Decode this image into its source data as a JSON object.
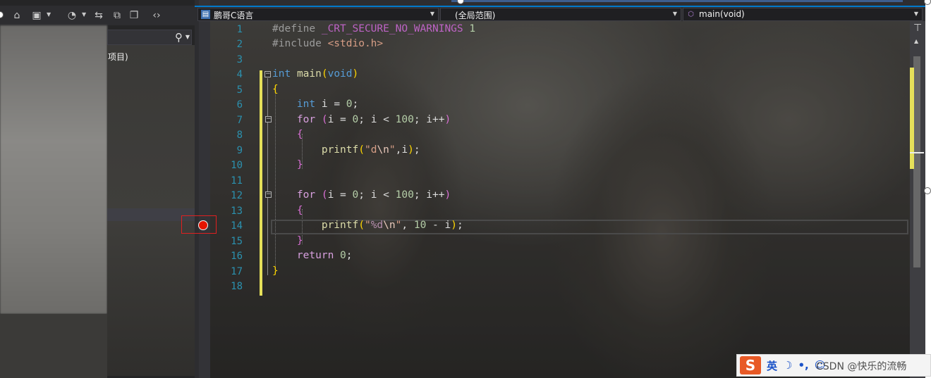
{
  "nav": {
    "file_combo": "鹏哥C语言",
    "scope_combo": "(全局范围)",
    "member_combo": "main(void)"
  },
  "solution_explorer": {
    "tree_item_partial": "项目)"
  },
  "editor": {
    "line_numbers": [
      "1",
      "2",
      "3",
      "4",
      "5",
      "6",
      "7",
      "8",
      "9",
      "10",
      "11",
      "12",
      "13",
      "14",
      "15",
      "16",
      "17",
      "18"
    ],
    "lines": {
      "l1_pp": "#define",
      "l1_macro": "_CRT_SECURE_NO_WARNINGS",
      "l1_num": "1",
      "l2_pp": "#include",
      "l2_header": "<stdio.h>",
      "l4_kw": "int",
      "l4_name": "main",
      "l4_open": "(",
      "l4_param": "void",
      "l4_close": ")",
      "l5": "{",
      "l6_kw": "int",
      "l6_rest": " i = ",
      "l6_num": "0",
      "l6_end": ";",
      "l7_kw": "for",
      "l7_open": "(",
      "l7_a": "i = ",
      "l7_n0": "0",
      "l7_b": "; i < ",
      "l7_n100": "100",
      "l7_c": "; i++",
      "l7_close": ")",
      "l8": "{",
      "l9_fn": "printf",
      "l9_open": "(",
      "l9_str_a": "\"d",
      "l9_esc": "\\n",
      "l9_str_b": "\"",
      "l9_args": ",i",
      "l9_close": ")",
      "l9_end": ";",
      "l10": "}",
      "l12_kw": "for",
      "l12_open": "(",
      "l12_a": "i = ",
      "l12_n0": "0",
      "l12_b": "; i < ",
      "l12_n100": "100",
      "l12_c": "; i++",
      "l12_close": ")",
      "l13": "{",
      "l14_fn": "printf",
      "l14_open": "(",
      "l14_str_a": "\"",
      "l14_fmt": "%d",
      "l14_esc": "\\n",
      "l14_str_b": "\"",
      "l14_args_a": ", ",
      "l14_n10": "10",
      "l14_args_b": " - i",
      "l14_close": ")",
      "l14_end": ";",
      "l15": "}",
      "l16_kw": "return",
      "l16_sp": " ",
      "l16_num": "0",
      "l16_end": ";",
      "l17": "}"
    },
    "breakpoint_line": "14"
  },
  "ime": {
    "logo": "S",
    "lang": "英",
    "moon": "☽",
    "punct": "•,",
    "emoji": "☺",
    "watermark": "CSDN @快乐的流畅"
  },
  "colors": {
    "accent": "#007acc",
    "breakpoint": "#e51400",
    "change_bar": "#e5e05a"
  }
}
